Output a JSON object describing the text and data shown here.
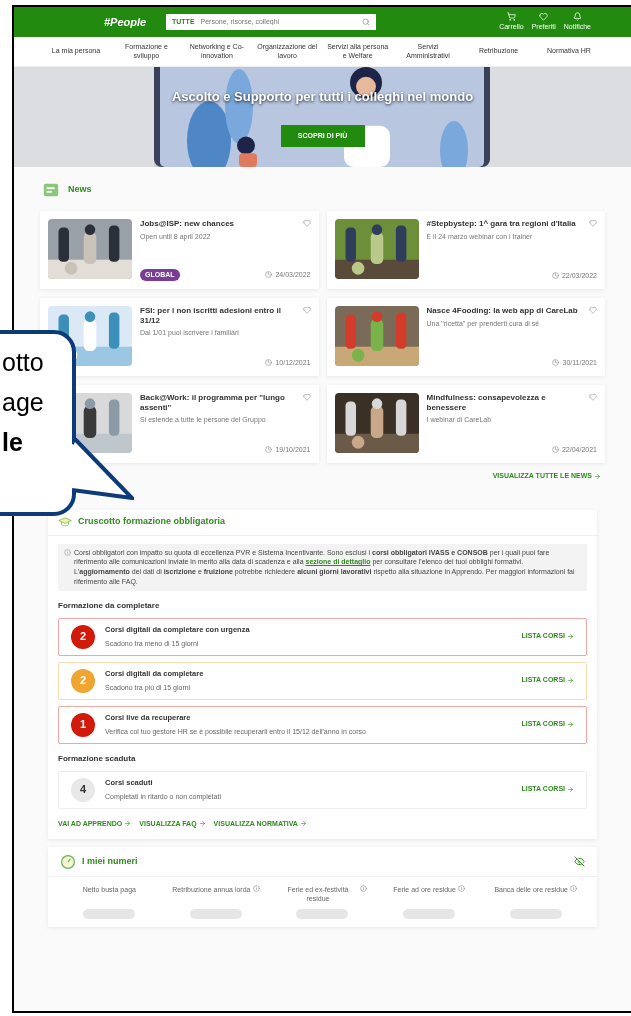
{
  "header": {
    "logo": "#People",
    "search": {
      "scope": "TUTTE",
      "placeholder": "Persone, risorse, colleghi"
    },
    "actions": [
      {
        "kind": "cart",
        "label": "Carrello"
      },
      {
        "kind": "heart",
        "label": "Preferiti"
      },
      {
        "kind": "bell",
        "label": "Notifiche"
      }
    ]
  },
  "nav": [
    "La mia persona",
    "Formazione e sviluppo",
    "Networking e Co-innovation",
    "Organizzazione del lavoro",
    "Servizi alla persona e Welfare",
    "Servizi Amministrativi",
    "Retribuzione",
    "Normativa HR"
  ],
  "hero": {
    "title": "Ascolto e Supporto per tutti i colleghi nel mondo",
    "button": "SCOPRI DI PIÙ"
  },
  "news": {
    "title": "News",
    "items": [
      {
        "title": "Jobs@ISP: new chances",
        "subtitle": "Open until 8 april 2022",
        "tag": "GLOBAL",
        "date": "24/03/2022",
        "liked": false
      },
      {
        "title": "#Stepbystep: 1^ gara tra regioni d'Italia",
        "subtitle": "E il 24 marzo webinar con i trainer",
        "date": "22/03/2022",
        "liked": false
      },
      {
        "title": "FSI: per i non iscritti adesioni entro il 31/12",
        "subtitle": "Dal 1/01 puoi iscrivere i familiari",
        "date": "10/12/2021",
        "liked": false
      },
      {
        "title": "Nasce 4Fooding: la web app di CareLab",
        "subtitle": "Una \"ricetta\" per prenderti cura di sé",
        "date": "30/11/2021",
        "liked": false
      },
      {
        "title": "Back@Work: il programma per \"lungo assenti\"",
        "subtitle": "Si estende a tutte le persone del Gruppo",
        "date": "19/10/2021",
        "liked": false
      },
      {
        "title": "Mindfulness: consapevolezza e benessere",
        "subtitle": "I webinar di CareLab",
        "date": "22/04/2021",
        "liked": false
      }
    ],
    "more": "VISUALIZZA TUTTE LE NEWS"
  },
  "training": {
    "title": "Cruscotto formazione obbligatoria",
    "info": {
      "before": "Corsi obbligatori con impatto su quota di eccellenza PVR e Sistema Incentivante. Sono esclusi i **corsi obbligatori IVASS e CONSOB** per i quali puoi fare riferimento alle comunicazioni inviate in merito alla data di scadenza e alla",
      "link": "sezione di dettaglio",
      "after": "per consultare l'elenco dei tuoi obblighi formativi.",
      "second": "L'**aggiornamento** dei dati di **iscrizione** e **fruizione** potrebbe richiedere **alcuni giorni lavorativi** rispetto alla situazione in Apprendo. Per maggiori informazioni fai riferimento alle FAQ."
    },
    "sections": [
      {
        "title": "Formazione da completare",
        "items": [
          {
            "kind": "urgent",
            "count": "2",
            "title": "Corsi digitali da completare con urgenza",
            "subtitle": "Scadono tra meno di 15 giorni",
            "link": "LISTA CORSI"
          },
          {
            "kind": "warning",
            "count": "2",
            "title": "Corsi digitali da completare",
            "subtitle": "Scadono tra più di 15 giorni",
            "link": "LISTA CORSI"
          },
          {
            "kind": "urgent",
            "count": "1",
            "title": "Corsi live da recuperare",
            "subtitle": "Verifica col tuo gestore HR se è possibile recuperarli entro il 15/12 dell'anno in corso",
            "link": "LISTA CORSI"
          }
        ]
      },
      {
        "title": "Formazione scaduta",
        "items": [
          {
            "kind": "expired",
            "count": "4",
            "title": "Corsi scaduti",
            "subtitle": "Completati in ritardo o non completati",
            "link": "LISTA CORSI"
          }
        ]
      }
    ],
    "links": [
      "VAI AD APPRENDO",
      "VISUALIZZA FAQ",
      "VISUALIZZA NORMATIVA"
    ]
  },
  "numbers": {
    "title": "I miei numeri",
    "items": [
      {
        "label": "Netto busta paga",
        "info": false
      },
      {
        "label": "Retribuzione annua lorda",
        "info": true
      },
      {
        "label": "Ferie ed ex-festività residue",
        "info": true
      },
      {
        "label": "Ferie ad ore residue",
        "info": true
      },
      {
        "label": "Banca delle ore residue",
        "info": true
      }
    ]
  },
  "callout": {
    "lines": [
      {
        "text": "otto",
        "bold": false
      },
      {
        "text": "age",
        "bold": false
      },
      {
        "text": "le",
        "bold": true
      }
    ]
  }
}
